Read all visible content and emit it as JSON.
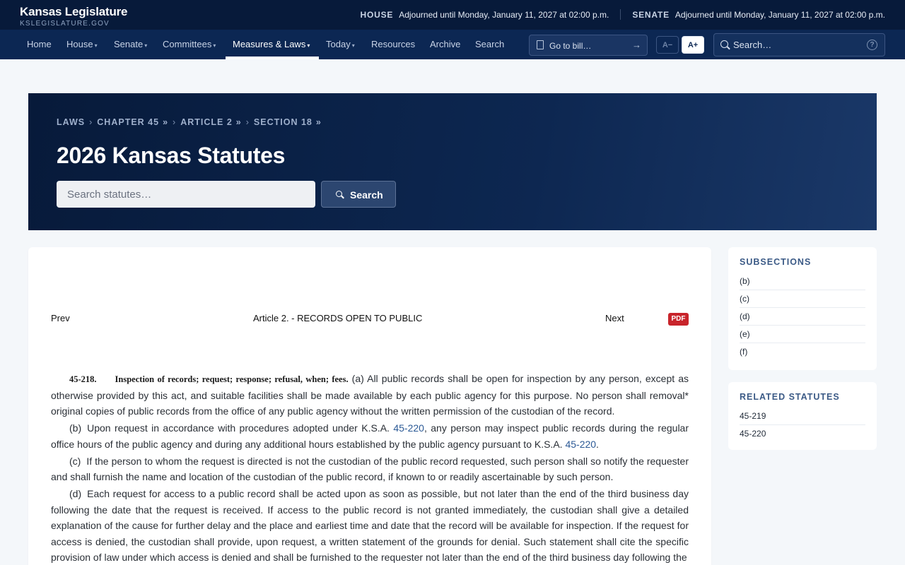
{
  "site": {
    "title": "Kansas Legislature",
    "subtitle": "KSLEGISLATURE.GOV"
  },
  "status": {
    "house_label": "HOUSE",
    "house_text": "Adjourned until Monday, January 11, 2027 at 02:00 p.m.",
    "senate_label": "SENATE",
    "senate_text": "Adjourned until Monday, January 11, 2027 at 02:00 p.m."
  },
  "nav": {
    "home": "Home",
    "house": "House",
    "senate": "Senate",
    "committees": "Committees",
    "measures": "Measures & Laws",
    "today": "Today",
    "resources": "Resources",
    "archive": "Archive",
    "search": "Search",
    "caret": "▾",
    "active": "Measures & Laws"
  },
  "goto_bill": {
    "label": "Go to bill…",
    "arrow": "→",
    "icon": "document-icon"
  },
  "font_size": {
    "decrease": "A−",
    "increase": "A+"
  },
  "top_search": {
    "placeholder": "Search…",
    "help": "?"
  },
  "breadcrumb": {
    "laws": "LAWS",
    "chapter": "CHAPTER 45",
    "article": "ARTICLE 2",
    "section": "SECTION 18",
    "sep": "›",
    "more": "»"
  },
  "hero": {
    "title": "2026 Kansas Statutes",
    "search_placeholder": "Search statutes…",
    "search_button": "Search"
  },
  "article_nav": {
    "prev": "Prev",
    "title": "Article 2. - RECORDS OPEN TO PUBLIC",
    "next": "Next",
    "pdf": "PDF"
  },
  "statute": {
    "number": "45-218.",
    "heading": "Inspection of records; request; response; refusal, when; fees.",
    "a_text": "(a) All public records shall be open for inspection by any person, except as otherwise provided by this act, and suitable facilities shall be made available by each public agency for this purpose. No person shall removal* original copies of public records from the office of any public agency without the written permission of the custodian of the record.",
    "b_label": "(b)",
    "b_text1": "Upon request in accordance with procedures adopted under K.S.A. ",
    "b_link1": "45-220",
    "b_text2": ", any person may inspect public records during the regular office hours of the public agency and during any additional hours established by the public agency pursuant to K.S.A. ",
    "b_link2": "45-220",
    "b_text3": ".",
    "c_label": "(c)",
    "c_text": "If the person to whom the request is directed is not the custodian of the public record requested, such person shall so notify the requester and shall furnish the name and location of the custodian of the public record, if known to or readily ascertainable by such person.",
    "d_label": "(d)",
    "d_text": "Each request for access to a public record shall be acted upon as soon as possible, but not later than the end of the third business day following the date that the request is received. If access to the public record is not granted immediately, the custodian shall give a detailed explanation of the cause for further delay and the place and earliest time and date that the record will be available for inspection. If the request for access is denied, the custodian shall provide, upon request, a written statement of the grounds for denial. Such statement shall cite the specific provision of law under which access is denied and shall be furnished to the requester not later than the end of the third business day following the"
  },
  "subsections": {
    "heading": "SUBSECTIONS",
    "items": [
      "(b)",
      "(c)",
      "(d)",
      "(e)",
      "(f)"
    ]
  },
  "related": {
    "heading": "RELATED STATUTES",
    "items": [
      "45-219",
      "45-220"
    ]
  },
  "colors": {
    "navy": "#071a3a",
    "nav": "#0c2753",
    "pdf_red": "#c8242b",
    "link": "#2c5a96"
  }
}
